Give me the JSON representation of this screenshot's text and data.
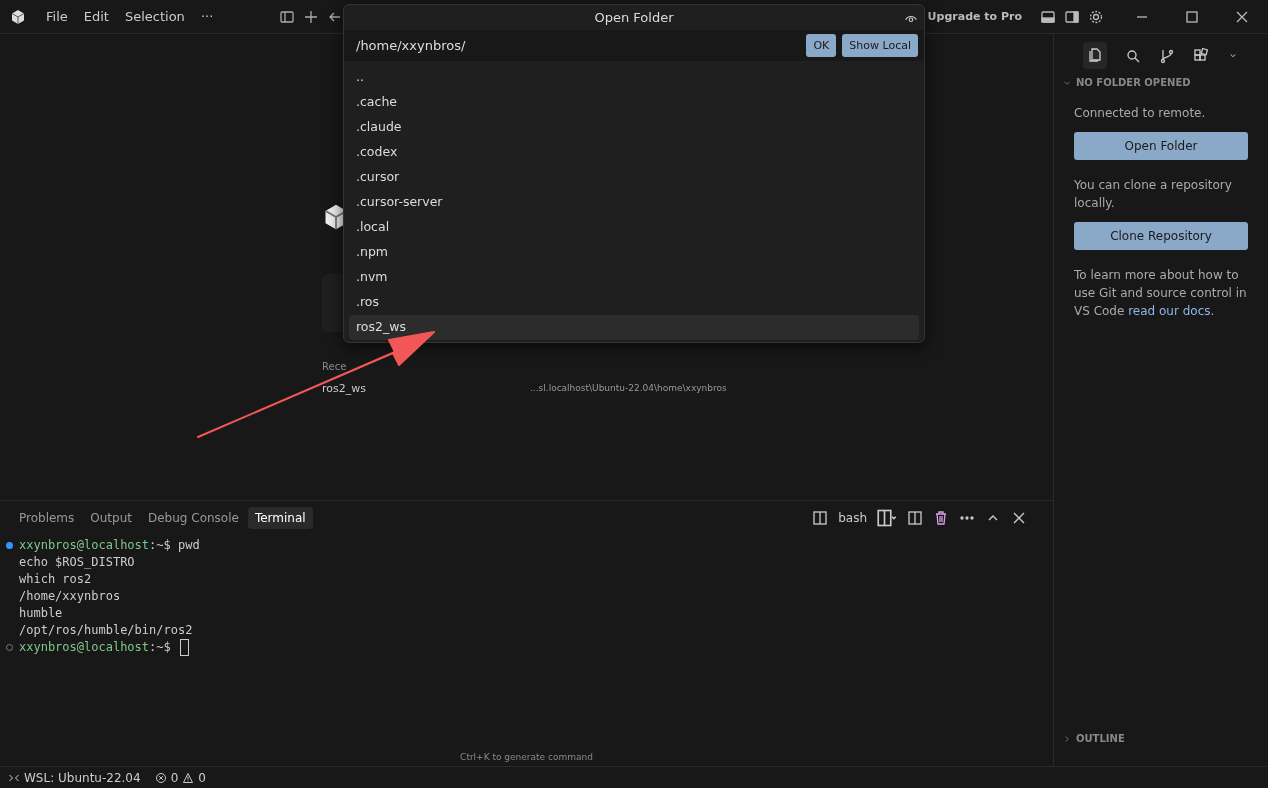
{
  "title_bar": {
    "menu": [
      "File",
      "Edit",
      "Selection",
      "···"
    ],
    "upgrade": "Upgrade to Pro"
  },
  "dialog": {
    "title": "Open Folder",
    "path": "/home/xxynbros/",
    "buttons": [
      "OK",
      "Show Local"
    ],
    "entries": [
      {
        "name": "..",
        "selected": false
      },
      {
        "name": ".cache",
        "selected": false
      },
      {
        "name": ".claude",
        "selected": false
      },
      {
        "name": ".codex",
        "selected": false
      },
      {
        "name": ".cursor",
        "selected": false
      },
      {
        "name": ".cursor-server",
        "selected": false
      },
      {
        "name": ".local",
        "selected": false
      },
      {
        "name": ".npm",
        "selected": false
      },
      {
        "name": ".nvm",
        "selected": false
      },
      {
        "name": ".ros",
        "selected": false
      },
      {
        "name": "ros2_ws",
        "selected": true
      }
    ]
  },
  "editor": {
    "recent_label": "Rece",
    "recent": [
      {
        "name": "ros2_ws",
        "path": "...sl.localhost\\Ubuntu-22.04\\home\\xxynbros"
      }
    ]
  },
  "panel": {
    "tabs": [
      {
        "label": "Problems",
        "selected": false
      },
      {
        "label": "Output",
        "selected": false
      },
      {
        "label": "Debug Console",
        "selected": false
      },
      {
        "label": "Terminal",
        "selected": true
      }
    ],
    "profile": "bash",
    "lines": [
      {
        "kind": "prompt",
        "user": "xxynbros@localhost",
        "cwd": ":~$",
        "command": "pwd",
        "dot_filled": true,
        "cursor": false
      },
      {
        "kind": "output",
        "text": "echo $ROS_DISTRO"
      },
      {
        "kind": "output",
        "text": "which ros2"
      },
      {
        "kind": "output",
        "text": "/home/xxynbros"
      },
      {
        "kind": "output",
        "text": "humble"
      },
      {
        "kind": "output",
        "text": "/opt/ros/humble/bin/ros2"
      },
      {
        "kind": "prompt",
        "user": "xxynbros@localhost",
        "cwd": ":~$",
        "dot_filled": false,
        "cursor": true
      }
    ],
    "hint": "Ctrl+K to generate command"
  },
  "sidebar": {
    "section": "NO FOLDER OPENED",
    "connected": "Connected to remote.",
    "open_button": "Open Folder",
    "clone_text": "You can clone a repository locally.",
    "clone_button": "Clone Repository",
    "learn_text": "To learn more about how to use Git and source control in VS Code ",
    "learn_link": "read our docs",
    "learn_end": ".",
    "bottom_section": "OUTLINE"
  },
  "status_bar": {
    "remote": "WSL: Ubuntu-22.04",
    "errors": "0",
    "warnings": "0"
  }
}
